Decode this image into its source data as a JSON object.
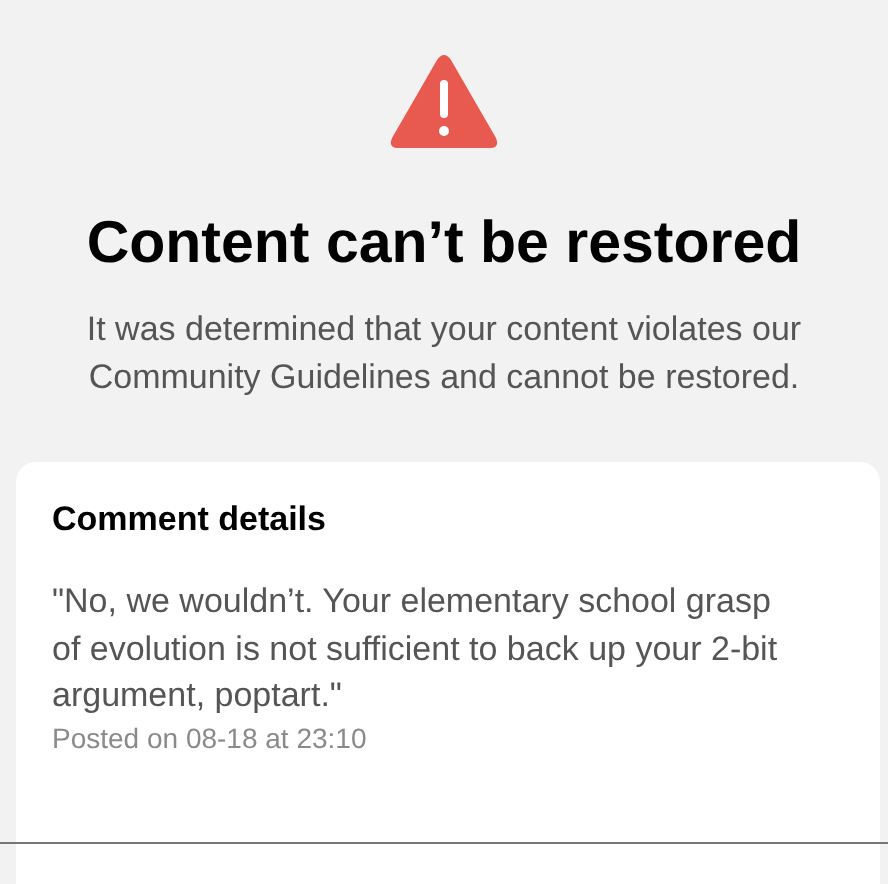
{
  "header": {
    "title": "Content can’t be restored",
    "message": "It was determined that your content violates our Community Guidelines and cannot be restored."
  },
  "comment": {
    "heading": "Comment details",
    "text": "\"No, we wouldn’t. Your elementary school grasp of evolution is not sufficient to back up your 2-bit argument, poptart.\"",
    "posted": "Posted on 08-18 at 23:10"
  }
}
